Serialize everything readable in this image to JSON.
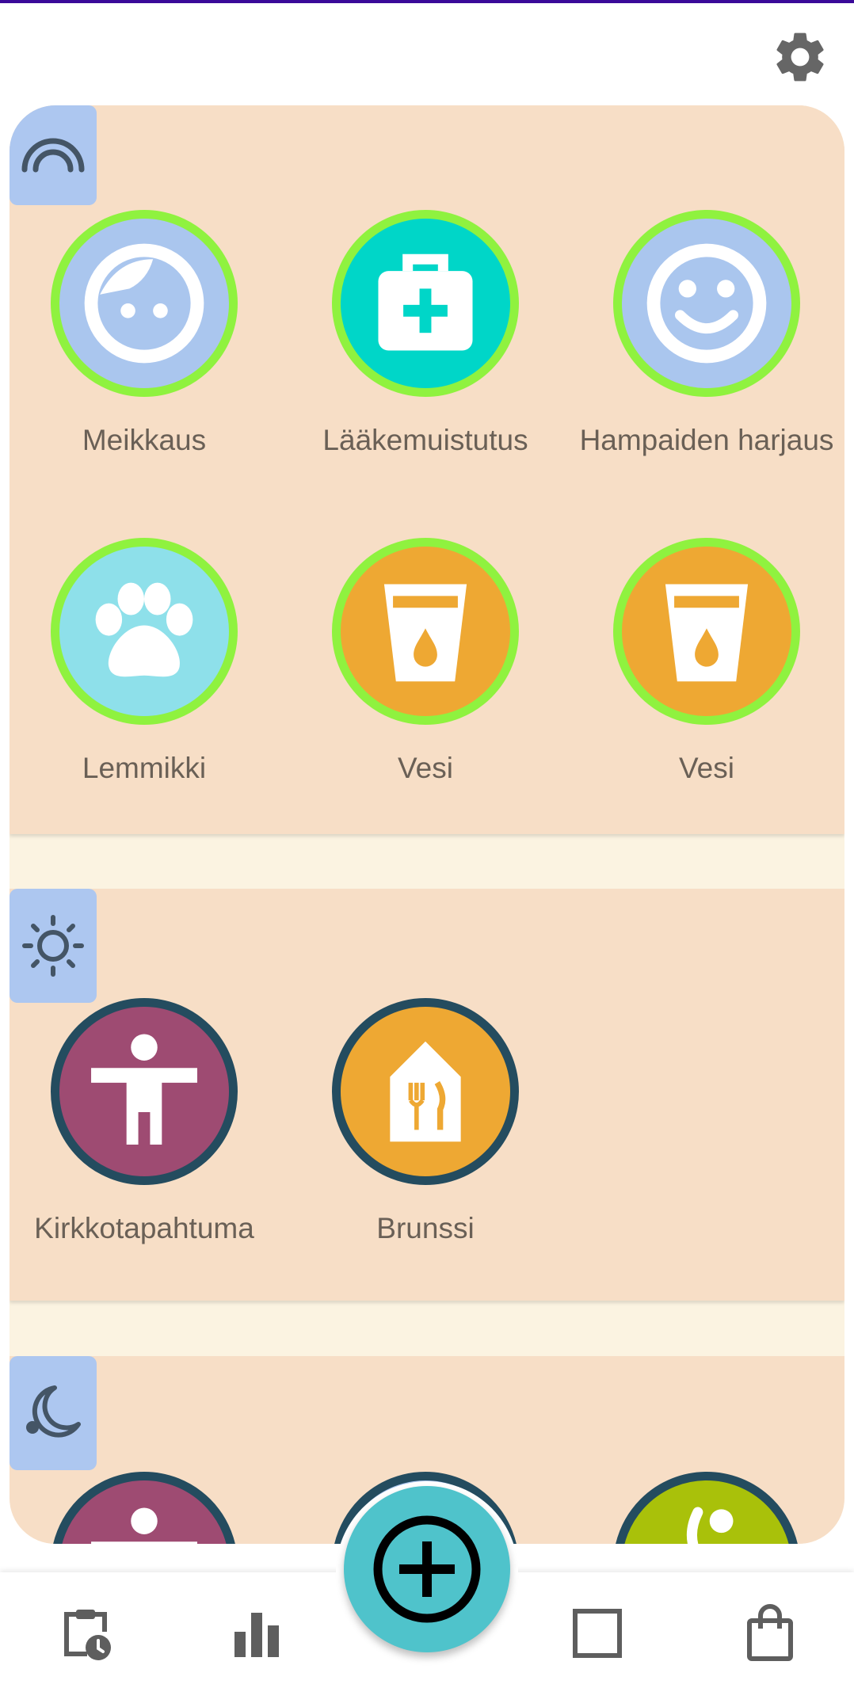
{
  "sections": [
    {
      "name": "morning",
      "icon": "rainbow-icon",
      "tasks": [
        {
          "label": "Meikkaus",
          "icon": "face-icon",
          "color": "#aac6ee",
          "ring": "#8ff23f"
        },
        {
          "label": "Lääkemuistutus",
          "icon": "medical-bag-icon",
          "color": "#00d6c8",
          "ring": "#8ff23f"
        },
        {
          "label": "Hampaiden harjaus",
          "icon": "smiley-icon",
          "color": "#aac6ee",
          "ring": "#8ff23f"
        },
        {
          "label": "Lemmikki",
          "icon": "paw-icon",
          "color": "#8ee0ea",
          "ring": "#8ff23f"
        },
        {
          "label": "Vesi",
          "icon": "water-cup-icon",
          "color": "#eea833",
          "ring": "#8ff23f"
        },
        {
          "label": "Vesi",
          "icon": "water-cup-icon",
          "color": "#eea833",
          "ring": "#8ff23f"
        }
      ]
    },
    {
      "name": "day",
      "icon": "sun-icon",
      "tasks": [
        {
          "label": "Kirkkotapahtuma",
          "icon": "person-icon",
          "color": "#9e4b72",
          "ring": "#244c5f"
        },
        {
          "label": "Brunssi",
          "icon": "restaurant-icon",
          "color": "#eea833",
          "ring": "#244c5f"
        }
      ]
    },
    {
      "name": "evening",
      "icon": "moon-icon",
      "tasks": [
        {
          "icon": "person-icon",
          "color": "#9e4b72",
          "ring": "#244c5f"
        },
        {
          "icon": "face-icon",
          "color": "#aac6ee",
          "ring": "#244c5f"
        },
        {
          "icon": "exercise-icon",
          "color": "#a9c10a",
          "ring": "#244c5f"
        }
      ]
    }
  ],
  "nav": [
    {
      "icon": "clipboard-clock-icon"
    },
    {
      "icon": "bar-chart-icon"
    },
    {
      "icon": "add-icon"
    },
    {
      "icon": "square-icon"
    },
    {
      "icon": "shopping-bag-icon"
    }
  ],
  "colors": {
    "section_bg": "#f7dec6",
    "divider_bg": "#fbf3e1",
    "section_icon_bg": "#adc7f0",
    "fab": "#4fc3cb",
    "nav_icon": "#5e5e5e"
  }
}
